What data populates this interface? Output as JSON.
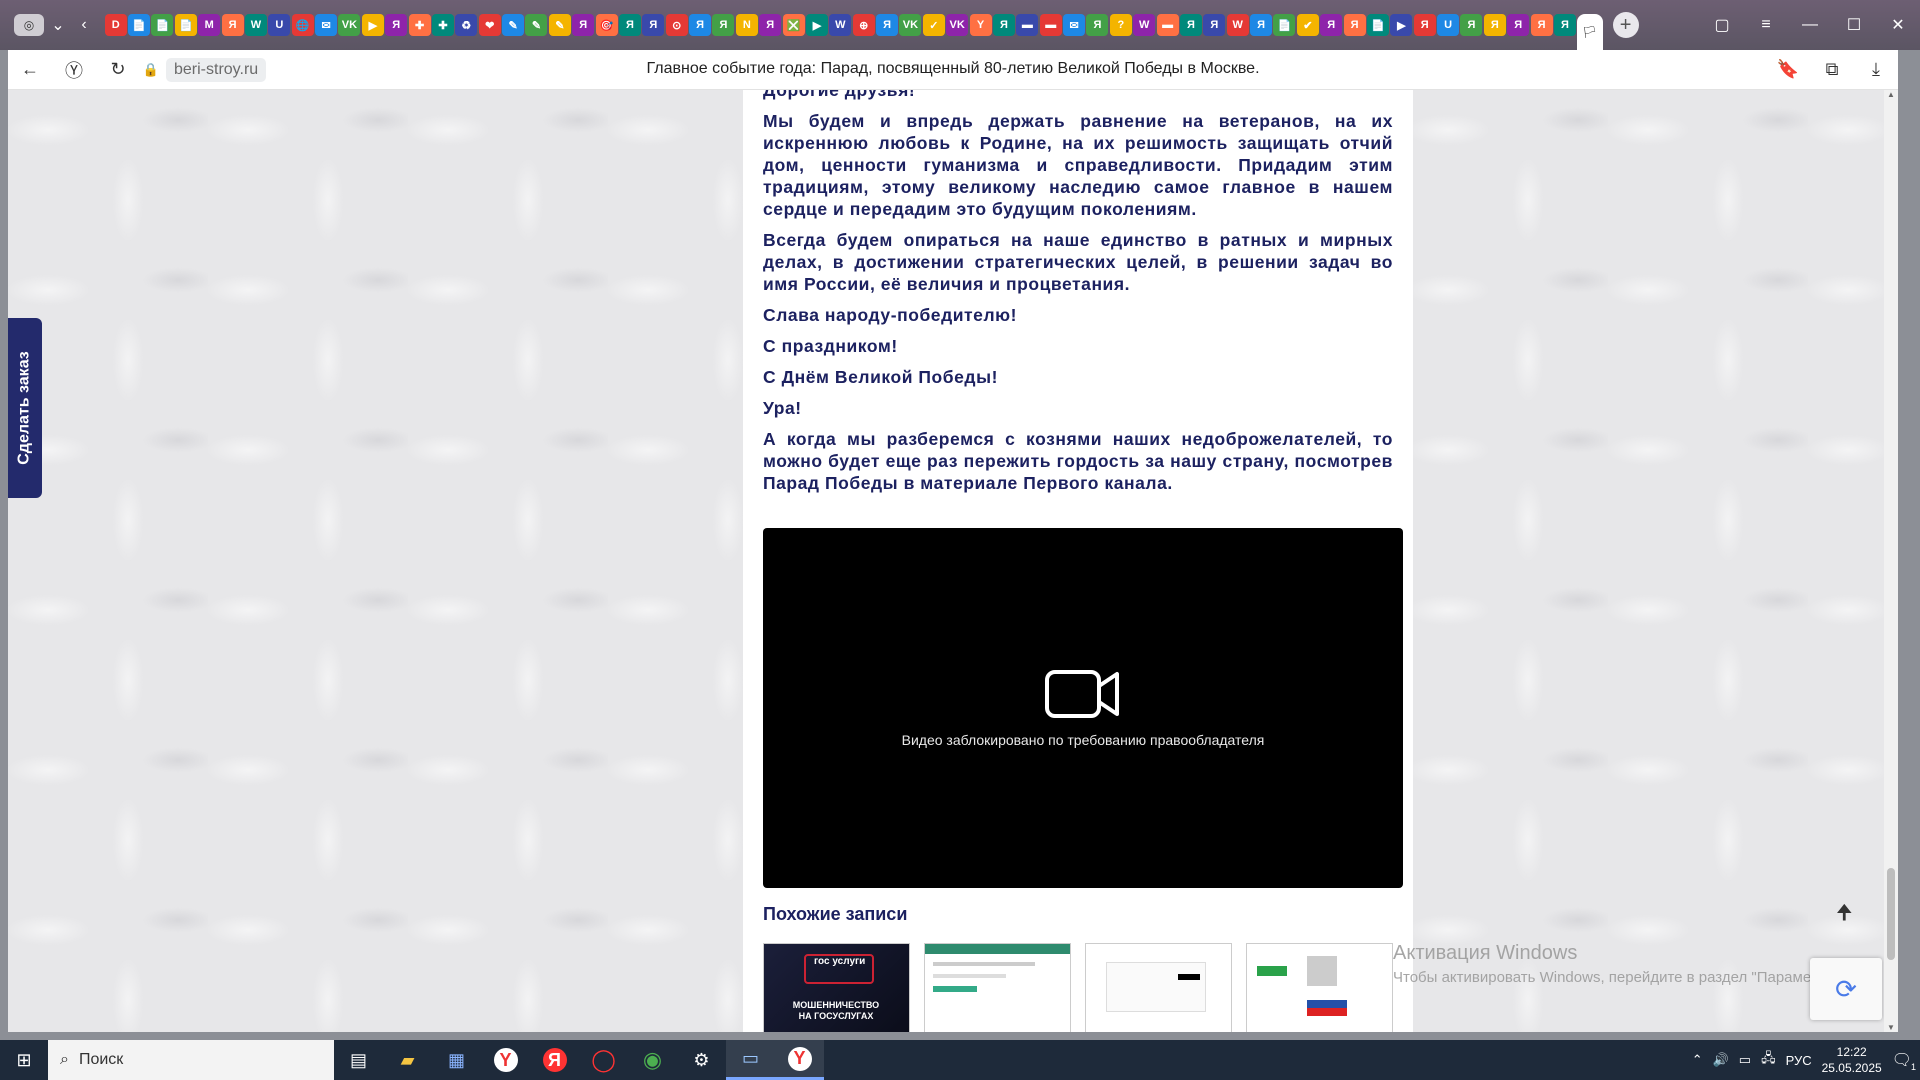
{
  "browser": {
    "url": "beri-stroy.ru",
    "title": "Главное событие года: Парад, посвященный 80-летию Великой Победы в Москве.",
    "tabs_icons": [
      "D",
      "📄",
      "📄",
      "📄",
      "M",
      "Я",
      "W",
      "U",
      "🌐",
      "✉",
      "VK",
      "▶",
      "Я",
      "✚",
      "✚",
      "♻",
      "❤",
      "✎",
      "✎",
      "✎",
      "Я",
      "🎯",
      "Я",
      "Я",
      "⊙",
      "Я",
      "Я",
      "N",
      "Я",
      "❎",
      "▶",
      "W",
      "⊕",
      "Я",
      "VK",
      "✓",
      "VK",
      "Y",
      "Я",
      "▬",
      "▬",
      "✉",
      "Я",
      "?",
      "W",
      "▬",
      "Я",
      "Я",
      "W",
      "Я",
      "📄",
      "✔",
      "Я",
      "Я",
      "📄",
      "▶",
      "Я",
      "U",
      "Я",
      "Я",
      "Я",
      "Я",
      "Я"
    ]
  },
  "sidebar": {
    "order_label": "Сделать заказ"
  },
  "article": {
    "partial_heading": "Дорогие друзья!",
    "paragraphs": [
      "Мы будем и впредь держать равнение на ветеранов, на их искреннюю любовь к Родине, на их решимость защищать отчий дом, ценности гуманизма и справедливости. Придадим этим традициям, этому великому наследию самое главное в нашем сердце и передадим это будущим поколениям.",
      "Всегда будем опираться на наше единство в ратных и мирных делах, в достижении стратегических целей, в решении задач во имя России, её величия и процветания.",
      "Слава народу-победителю!",
      "С праздником!",
      "С Днём Великой Победы!",
      "Ура!",
      "А когда мы разберемся с кознями наших недоброжелателей, то можно будет еще раз пережить гордость за нашу страну, посмотрев Парад Победы в материале Первого канала."
    ],
    "video_message": "Видео заблокировано по требованию правообладателя",
    "related_title": "Похожие записи",
    "thumb1_text": "МОШЕННИЧЕСТВО НА ГОСУСЛУГАХ",
    "thumb1_logo": "гос услуги"
  },
  "windows_activation": {
    "title": "Активация Windows",
    "subtitle": "Чтобы активировать Windows, перейдите в раздел \"Параметры\"."
  },
  "taskbar": {
    "search_placeholder": "Поиск",
    "lang": "РУС",
    "time": "12:22",
    "date": "25.05.2025",
    "notifications": "1"
  }
}
